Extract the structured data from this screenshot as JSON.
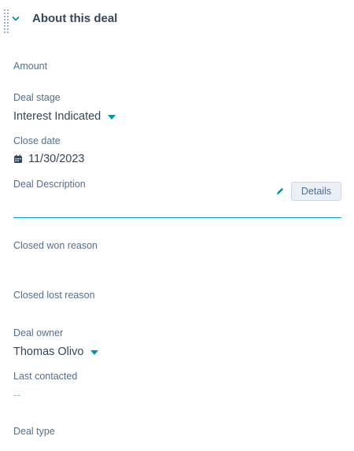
{
  "section": {
    "title": "About this deal"
  },
  "properties": {
    "amount": {
      "label": "Amount"
    },
    "deal_stage": {
      "label": "Deal stage",
      "value": "Interest Indicated"
    },
    "close_date": {
      "label": "Close date",
      "value": "11/30/2023"
    },
    "deal_description": {
      "label": "Deal Description",
      "details_button": "Details"
    },
    "closed_won_reason": {
      "label": "Closed won reason"
    },
    "closed_lost_reason": {
      "label": "Closed lost reason"
    },
    "deal_owner": {
      "label": "Deal owner",
      "value": "Thomas Olivo"
    },
    "last_contacted": {
      "label": "Last contacted",
      "value": "--"
    },
    "deal_type": {
      "label": "Deal type"
    }
  },
  "icons": {
    "section_toggle": "chevron-down-icon",
    "drag": "drag-handle-icon",
    "calendar": "calendar-icon",
    "edit": "pencil-icon",
    "dropdown": "caret-down-icon"
  },
  "colors": {
    "accent": "#0091ae",
    "text_primary": "#33475b",
    "text_label": "#516f90",
    "button_bg": "#eaf0f6",
    "underline": "#00a4bd"
  }
}
